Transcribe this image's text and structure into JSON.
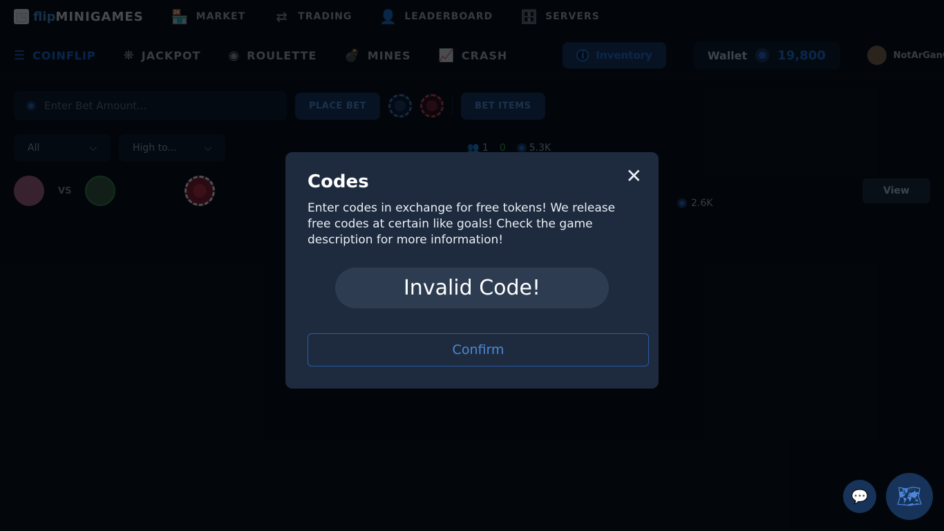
{
  "logo": {
    "flip": "flip",
    "mg": "MINIGAMES"
  },
  "topnav": [
    {
      "label": "MARKET"
    },
    {
      "label": "TRADING"
    },
    {
      "label": "LEADERBOARD"
    },
    {
      "label": "SERVERS"
    }
  ],
  "games": [
    {
      "label": "COINFLIP",
      "active": true
    },
    {
      "label": "JACKPOT"
    },
    {
      "label": "ROULETTE"
    },
    {
      "label": "MINES"
    },
    {
      "label": "CRASH"
    }
  ],
  "inventory_label": "Inventory",
  "wallet_label": "Wallet",
  "wallet_amount": "19,800",
  "username": "NotArGanOP",
  "bet_placeholder": "Enter Bet Amount...",
  "place_bet": "PLACE BET",
  "bet_items": "BET ITEMS",
  "filters": {
    "all": "All",
    "sort": "High to..."
  },
  "stats": {
    "people": "1",
    "online": "0",
    "pot": "5.3K"
  },
  "row2_val": "2.6K",
  "view": "View",
  "vs": "VS",
  "modal": {
    "title": "Codes",
    "desc": "Enter codes in exchange for free tokens! We release free codes at certain like goals! Check the game description for more information!",
    "input_value": "Invalid Code!",
    "confirm": "Confirm"
  }
}
